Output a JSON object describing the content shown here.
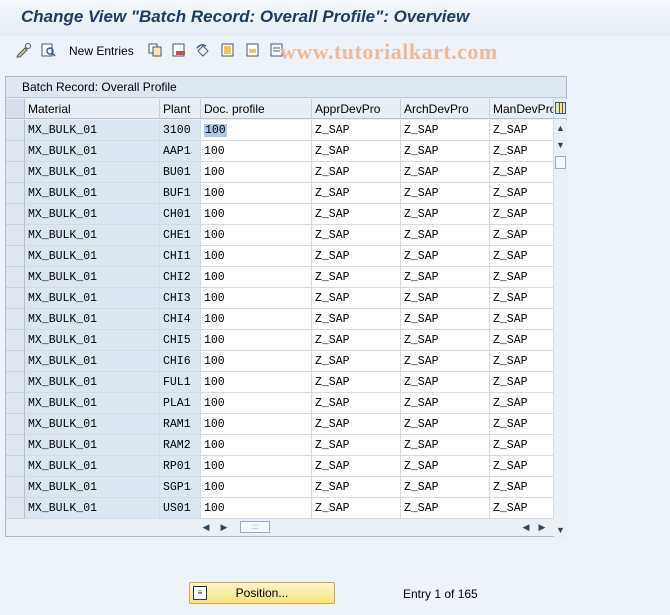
{
  "title": "Change View \"Batch Record: Overall Profile\": Overview",
  "toolbar": {
    "new_entries_label": "New Entries",
    "icons": [
      "glasses-pencil-icon",
      "display-change-icon",
      "copy-icon",
      "delete-icon",
      "undo-icon",
      "select-all-icon",
      "select-block-icon",
      "deselect-all-icon"
    ]
  },
  "watermark": "www.tutorialkart.com",
  "panel": {
    "title": "Batch Record: Overall Profile",
    "columns": [
      "Material",
      "Plant",
      "Doc. profile",
      "ApprDevPro",
      "ArchDevPro",
      "ManDevPro"
    ],
    "rows": [
      [
        "MX_BULK_01",
        "3100",
        "100",
        "Z_SAP",
        "Z_SAP",
        "Z_SAP"
      ],
      [
        "MX_BULK_01",
        "AAP1",
        "100",
        "Z_SAP",
        "Z_SAP",
        "Z_SAP"
      ],
      [
        "MX_BULK_01",
        "BU01",
        "100",
        "Z_SAP",
        "Z_SAP",
        "Z_SAP"
      ],
      [
        "MX_BULK_01",
        "BUF1",
        "100",
        "Z_SAP",
        "Z_SAP",
        "Z_SAP"
      ],
      [
        "MX_BULK_01",
        "CH01",
        "100",
        "Z_SAP",
        "Z_SAP",
        "Z_SAP"
      ],
      [
        "MX_BULK_01",
        "CHE1",
        "100",
        "Z_SAP",
        "Z_SAP",
        "Z_SAP"
      ],
      [
        "MX_BULK_01",
        "CHI1",
        "100",
        "Z_SAP",
        "Z_SAP",
        "Z_SAP"
      ],
      [
        "MX_BULK_01",
        "CHI2",
        "100",
        "Z_SAP",
        "Z_SAP",
        "Z_SAP"
      ],
      [
        "MX_BULK_01",
        "CHI3",
        "100",
        "Z_SAP",
        "Z_SAP",
        "Z_SAP"
      ],
      [
        "MX_BULK_01",
        "CHI4",
        "100",
        "Z_SAP",
        "Z_SAP",
        "Z_SAP"
      ],
      [
        "MX_BULK_01",
        "CHI5",
        "100",
        "Z_SAP",
        "Z_SAP",
        "Z_SAP"
      ],
      [
        "MX_BULK_01",
        "CHI6",
        "100",
        "Z_SAP",
        "Z_SAP",
        "Z_SAP"
      ],
      [
        "MX_BULK_01",
        "FUL1",
        "100",
        "Z_SAP",
        "Z_SAP",
        "Z_SAP"
      ],
      [
        "MX_BULK_01",
        "PLA1",
        "100",
        "Z_SAP",
        "Z_SAP",
        "Z_SAP"
      ],
      [
        "MX_BULK_01",
        "RAM1",
        "100",
        "Z_SAP",
        "Z_SAP",
        "Z_SAP"
      ],
      [
        "MX_BULK_01",
        "RAM2",
        "100",
        "Z_SAP",
        "Z_SAP",
        "Z_SAP"
      ],
      [
        "MX_BULK_01",
        "RP01",
        "100",
        "Z_SAP",
        "Z_SAP",
        "Z_SAP"
      ],
      [
        "MX_BULK_01",
        "SGP1",
        "100",
        "Z_SAP",
        "Z_SAP",
        "Z_SAP"
      ],
      [
        "MX_BULK_01",
        "US01",
        "100",
        "Z_SAP",
        "Z_SAP",
        "Z_SAP"
      ]
    ]
  },
  "footer": {
    "position_label": "Position...",
    "entry_text": "Entry 1 of 165"
  }
}
